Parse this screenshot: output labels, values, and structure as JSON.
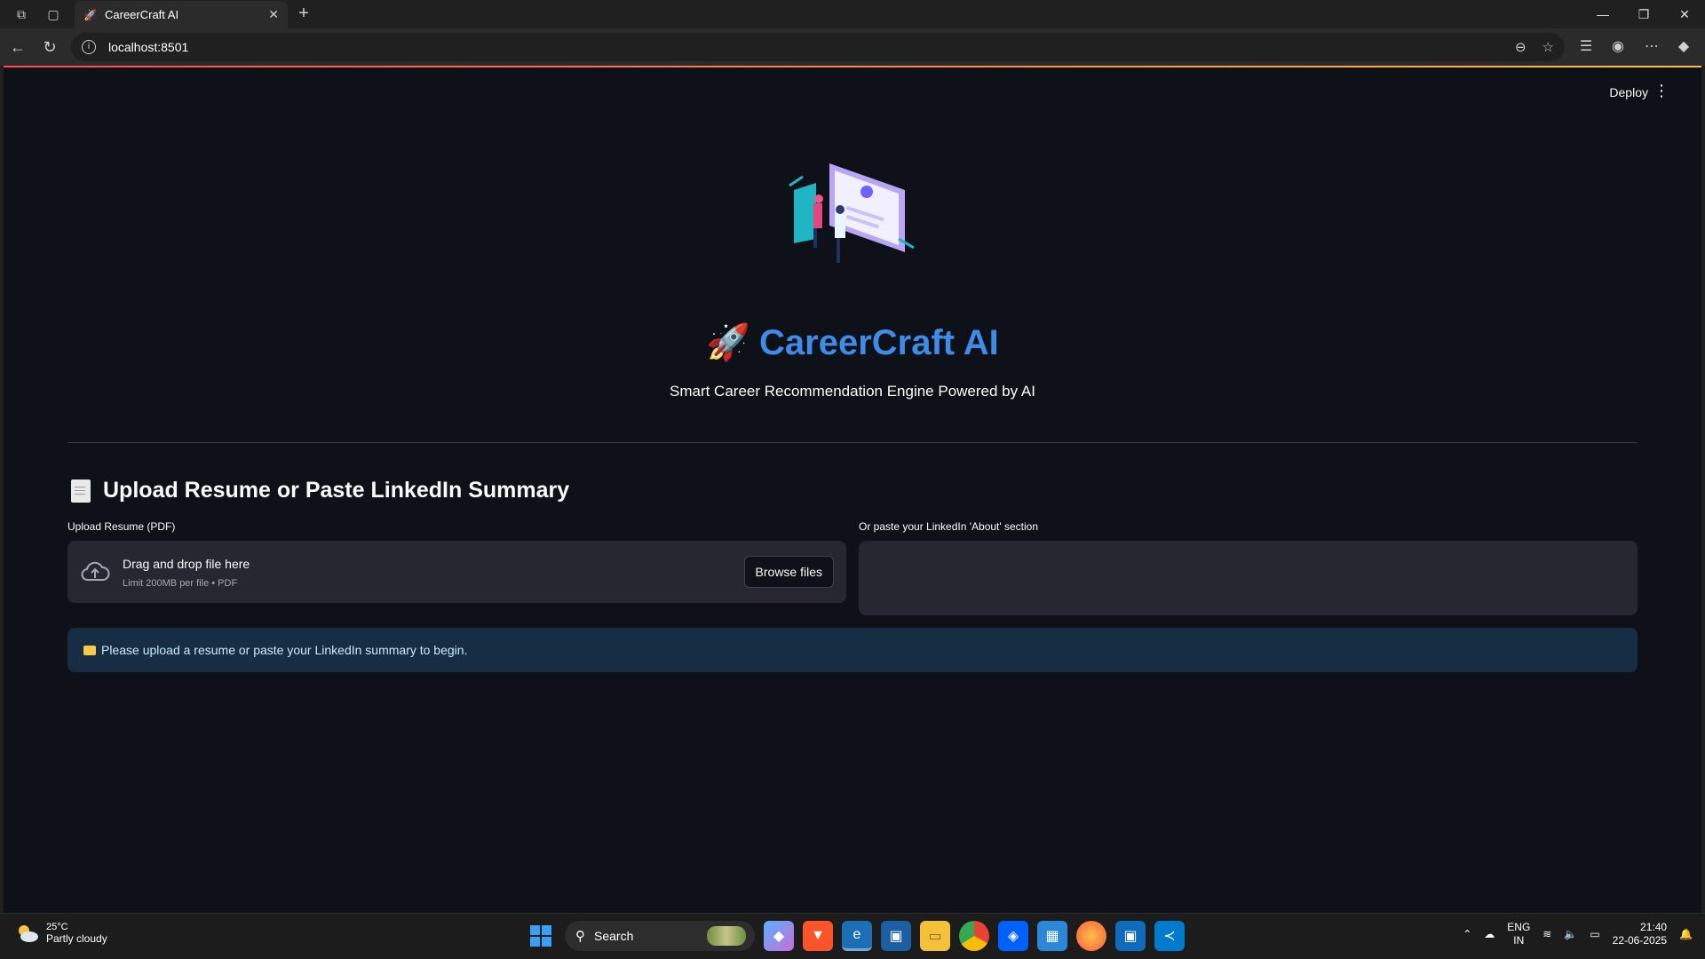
{
  "browser": {
    "tab_title": "CareerCraft AI",
    "url": "localhost:8501"
  },
  "app": {
    "deploy_label": "Deploy",
    "title": "CareerCraft AI",
    "subtitle": "Smart Career Recommendation Engine Powered by AI",
    "section_heading": "Upload Resume or Paste LinkedIn Summary",
    "upload_label": "Upload Resume (PDF)",
    "dropzone_title": "Drag and drop file here",
    "dropzone_limit": "Limit 200MB per file • PDF",
    "browse_label": "Browse files",
    "linkedin_label": "Or paste your LinkedIn 'About' section",
    "linkedin_value": "",
    "info_message": "Please upload a resume or paste your LinkedIn summary to begin."
  },
  "taskbar": {
    "temperature": "25°C",
    "weather": "Partly cloudy",
    "search_placeholder": "Search",
    "lang_top": "ENG",
    "lang_bottom": "IN",
    "time": "21:40",
    "date": "22-06-2025"
  },
  "colors": {
    "page_bg": "#0e1117",
    "title_blue": "#3f8be8",
    "widget_bg": "#262730",
    "info_bg": "#172d43"
  }
}
